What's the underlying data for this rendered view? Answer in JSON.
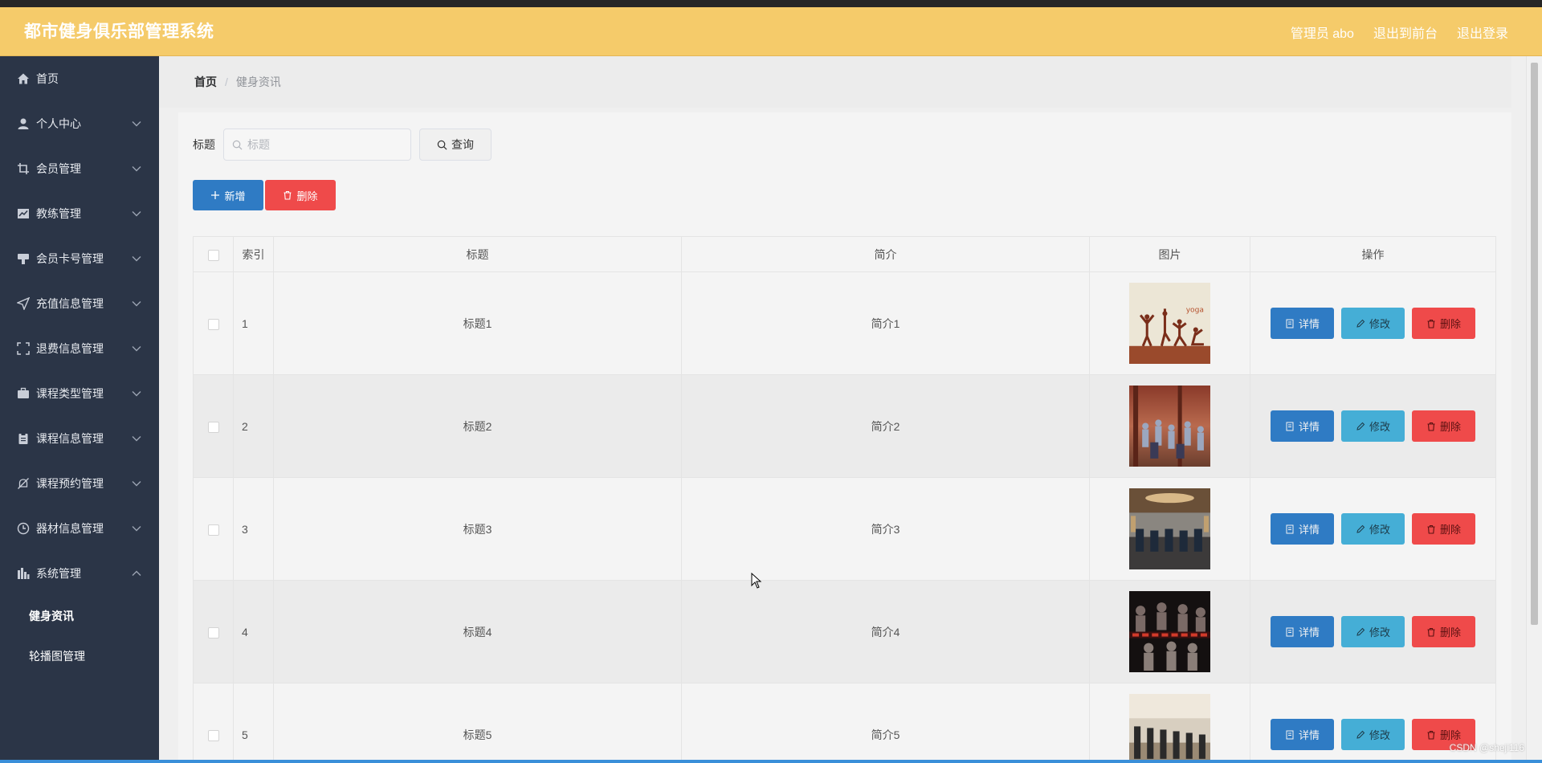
{
  "app": {
    "title": "都市健身俱乐部管理系统",
    "user_label": "管理员 abo",
    "back_to_front": "退出到前台",
    "logout": "退出登录"
  },
  "sidebar": {
    "items": [
      {
        "label": "首页",
        "icon": "home-icon"
      },
      {
        "label": "个人中心",
        "icon": "user-icon"
      },
      {
        "label": "会员管理",
        "icon": "crop-icon"
      },
      {
        "label": "教练管理",
        "icon": "chart-icon"
      },
      {
        "label": "会员卡号管理",
        "icon": "card-icon"
      },
      {
        "label": "充值信息管理",
        "icon": "send-icon"
      },
      {
        "label": "退费信息管理",
        "icon": "fullscreen-icon"
      },
      {
        "label": "课程类型管理",
        "icon": "briefcase-icon"
      },
      {
        "label": "课程信息管理",
        "icon": "clipboard-icon"
      },
      {
        "label": "课程预约管理",
        "icon": "bell-off-icon"
      },
      {
        "label": "器材信息管理",
        "icon": "clock-icon"
      },
      {
        "label": "系统管理",
        "icon": "data-icon"
      }
    ],
    "sub_items": [
      {
        "label": "健身资讯"
      },
      {
        "label": "轮播图管理"
      }
    ]
  },
  "breadcrumb": {
    "home": "首页",
    "separator": "/",
    "current": "健身资讯"
  },
  "search": {
    "label": "标题",
    "placeholder": "标题",
    "button": "查询"
  },
  "actions": {
    "add": "新增",
    "delete": "删除"
  },
  "table": {
    "headers": {
      "index": "索引",
      "title": "标题",
      "intro": "简介",
      "image": "图片",
      "ops": "操作"
    },
    "rows": [
      {
        "index": "1",
        "title": "标题1",
        "intro": "简介1",
        "image": "yoga-silhouettes-image"
      },
      {
        "index": "2",
        "title": "标题2",
        "intro": "简介2",
        "image": "group-fitness-class-image"
      },
      {
        "index": "3",
        "title": "标题3",
        "intro": "简介3",
        "image": "gym-interior-image"
      },
      {
        "index": "4",
        "title": "标题4",
        "intro": "简介4",
        "image": "dance-crowd-banner-image"
      },
      {
        "index": "5",
        "title": "标题5",
        "intro": "简介5",
        "image": "treadmill-room-image"
      }
    ],
    "row_buttons": {
      "detail": "详情",
      "edit": "修改",
      "delete": "删除"
    }
  },
  "watermark": "CSDN @sheji116",
  "colors": {
    "header": "#f5cb6a",
    "sidebar": "#2b3547",
    "primary": "#2f7bc4",
    "info": "#45aed6",
    "danger": "#ef4a4a"
  }
}
